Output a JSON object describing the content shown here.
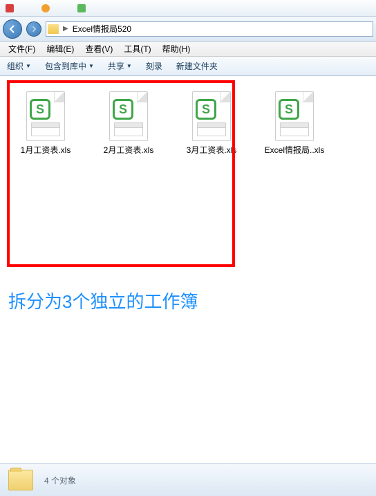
{
  "breadcrumb": {
    "folder": "Excel情报局520"
  },
  "menubar": {
    "file": "文件(F)",
    "edit": "编辑(E)",
    "view": "查看(V)",
    "tools": "工具(T)",
    "help": "帮助(H)"
  },
  "toolbar": {
    "organize": "组织",
    "include": "包含到库中",
    "share": "共享",
    "burn": "刻录",
    "newfolder": "新建文件夹"
  },
  "files": [
    {
      "name": "1月工资表.xls"
    },
    {
      "name": "2月工资表.xls"
    },
    {
      "name": "3月工资表.xls"
    },
    {
      "name": "Excel情报局..xls"
    }
  ],
  "annotation": "拆分为3个独立的工作簿",
  "status": {
    "count": "4 个对象"
  }
}
